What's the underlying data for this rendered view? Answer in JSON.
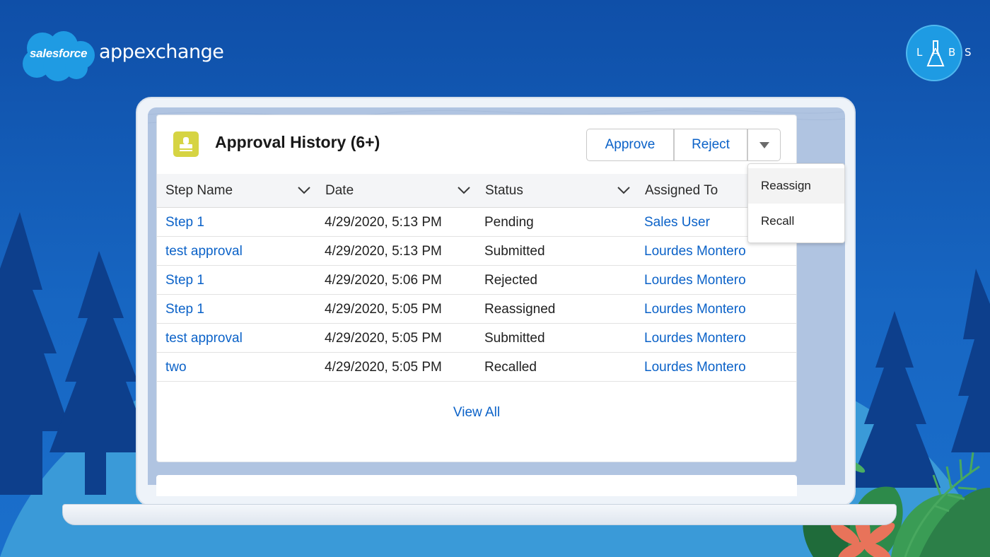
{
  "branding": {
    "cloud_label": "salesforce",
    "product_label": "appexchange",
    "badge_label": "LABS",
    "colors": {
      "background": "#1766c2",
      "cloud": "#1f9be3",
      "link": "#0b62c8",
      "icon": "#d6d443"
    }
  },
  "card": {
    "icon": "stamp-icon",
    "title": "Approval History (6+)",
    "actions": {
      "approve": "Approve",
      "reject": "Reject",
      "more_icon": "caret-down-icon"
    },
    "columns": [
      {
        "label": "Step Name",
        "sortable": true
      },
      {
        "label": "Date",
        "sortable": true
      },
      {
        "label": "Status",
        "sortable": true
      },
      {
        "label": "Assigned To",
        "sortable": false
      }
    ],
    "rows": [
      {
        "step": "Step 1",
        "date": "4/29/2020, 5:13 PM",
        "status": "Pending",
        "assigned": "Sales User"
      },
      {
        "step": "test approval",
        "date": "4/29/2020, 5:13 PM",
        "status": "Submitted",
        "assigned": "Lourdes Montero"
      },
      {
        "step": "Step 1",
        "date": "4/29/2020, 5:06 PM",
        "status": "Rejected",
        "assigned": "Lourdes Montero"
      },
      {
        "step": "Step 1",
        "date": "4/29/2020, 5:05 PM",
        "status": "Reassigned",
        "assigned": "Lourdes Montero"
      },
      {
        "step": "test approval",
        "date": "4/29/2020, 5:05 PM",
        "status": "Submitted",
        "assigned": "Lourdes Montero"
      },
      {
        "step": "two",
        "date": "4/29/2020, 5:05 PM",
        "status": "Recalled",
        "assigned": "Lourdes Montero"
      }
    ],
    "view_all": "View All"
  },
  "menu": {
    "items": [
      {
        "label": "Reassign",
        "active": true
      },
      {
        "label": "Recall",
        "active": false
      }
    ]
  }
}
